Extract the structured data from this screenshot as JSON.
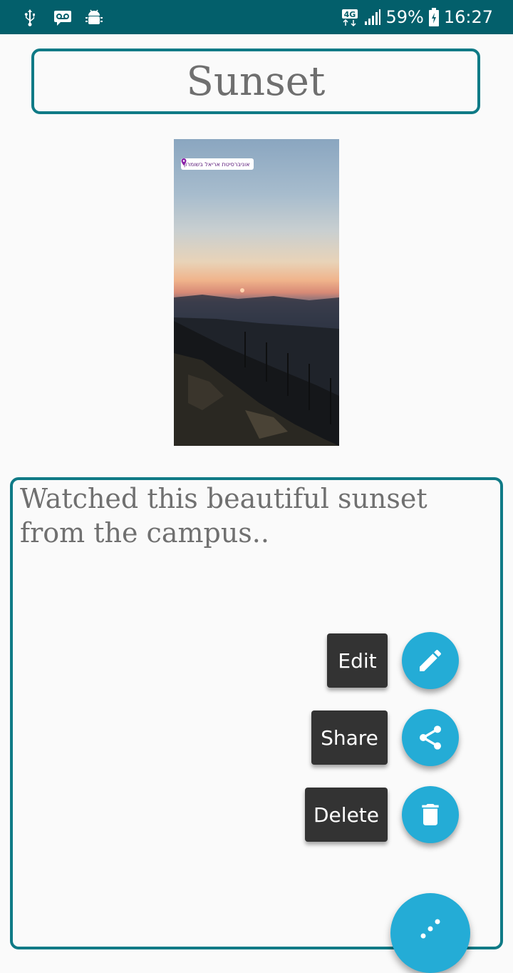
{
  "status_bar": {
    "network": "4G",
    "battery": "59%",
    "time": "16:27",
    "icons": [
      "usb-icon",
      "voicemail-icon",
      "android-debug-icon",
      "signal-icon",
      "battery-charging-icon"
    ]
  },
  "note": {
    "title": "Sunset",
    "description": "Watched this beautiful sunset from the campus..",
    "photo": {
      "location_sticker": "אוניברסיטת אריאל בשומרון"
    }
  },
  "actions": {
    "edit": {
      "label": "Edit",
      "icon": "pencil-icon"
    },
    "share": {
      "label": "Share",
      "icon": "share-icon"
    },
    "delete": {
      "label": "Delete",
      "icon": "trash-icon"
    },
    "main_fab_icon": "more-dots-icon"
  },
  "colors": {
    "status_bar": "#035f6b",
    "border_accent": "#0f7a86",
    "fab": "#24acd6",
    "label_bg": "#333333",
    "text_gray": "#707070"
  }
}
